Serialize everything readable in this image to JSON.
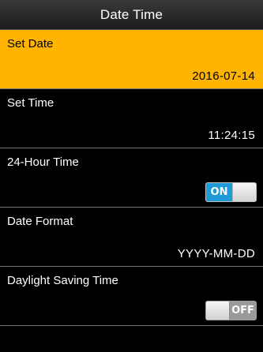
{
  "header": {
    "title": "Date Time"
  },
  "menu": {
    "items": [
      {
        "label": "Set Date",
        "value": "2016-07-14",
        "selected": true
      },
      {
        "label": "Set Time",
        "value": "11:24:15"
      },
      {
        "label": "24-Hour Time",
        "toggle": "ON"
      },
      {
        "label": "Date Format",
        "value": "YYYY-MM-DD"
      },
      {
        "label": "Daylight Saving Time",
        "toggle": "OFF"
      }
    ]
  },
  "colors": {
    "selection": "#ffb400",
    "toggle_on": "#1e9bd6",
    "toggle_off": "#9a9a9a",
    "background": "#000000"
  }
}
